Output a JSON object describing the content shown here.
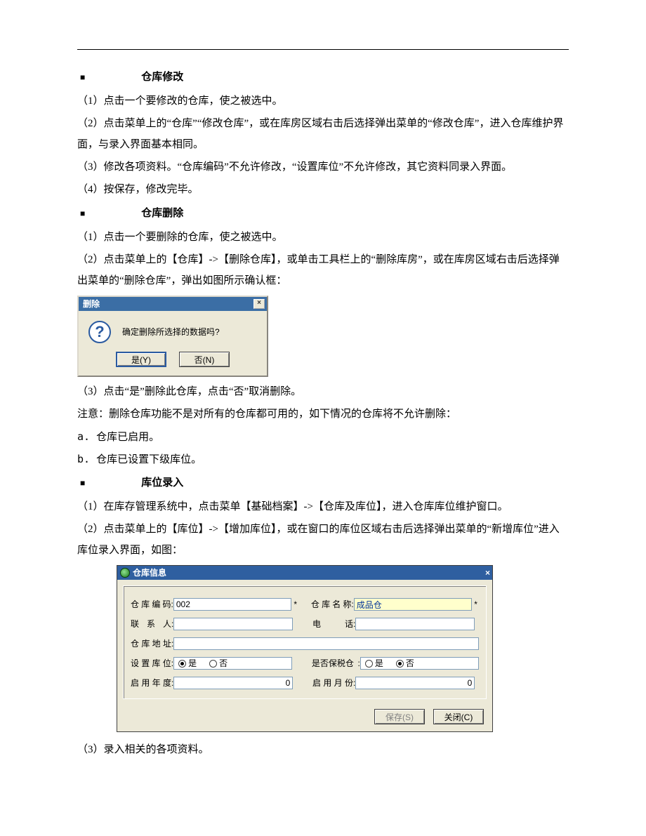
{
  "sections": {
    "modify": {
      "title": "仓库修改",
      "p1": "（1）点击一个要修改的仓库，使之被选中。",
      "p2": "（2）点击菜单上的“仓库”“修改仓库”，或在库房区域右击后选择弹出菜单的“修改仓库”，进入仓库维护界面，与录入界面基本相同。",
      "p3": "（3）修改各项资料。“仓库编码”不允许修改，“设置库位”不允许修改，其它资料同录入界面。",
      "p4": "（4）按保存，修改完毕。"
    },
    "delete": {
      "title": "仓库删除",
      "p1": "（1）点击一个要删除的仓库，使之被选中。",
      "p2": "（2）点击菜单上的【仓库】->【删除仓库】，或单击工具栏上的“删除库房”，或在库房区域右击后选择弹出菜单的“删除仓库”，弹出如图所示确认框：",
      "p3": "（3）点击“是”删除此仓库，点击“否”取消删除。",
      "note": "注意：删除仓库功能不是对所有的仓库都可用的，如下情况的仓库将不允许删除：",
      "a": "a. 仓库已启用。",
      "b": "b. 仓库已设置下级库位。"
    },
    "locInput": {
      "title": "库位录入",
      "p1": "（1）在库存管理系统中，点击菜单【基础档案】->【仓库及库位】，进入仓库库位维护窗口。",
      "p2": "（2）点击菜单上的【库位】->【增加库位】，或在窗口的库位区域右击后选择弹出菜单的“新增库位”进入库位录入界面，如图：",
      "p3": "（3）录入相关的各项资料。"
    }
  },
  "dialogs": {
    "confirm": {
      "title": "删除",
      "message": "确定删除所选择的数据吗?",
      "yes": "是(Y)",
      "no": "否(N)"
    },
    "info": {
      "title": "仓库信息",
      "labels": {
        "code": "仓库编码",
        "name": "仓库名称",
        "contact": "联 系 人",
        "phone": "电　　话",
        "address": "仓库地址",
        "setloc": "设置库位",
        "bonded": "是否保税仓",
        "year": "启用年度",
        "month": "启用月份"
      },
      "values": {
        "code": "002",
        "name": "成品仓",
        "contact": "",
        "phone": "",
        "address": "",
        "year": "0",
        "month": "0"
      },
      "radio": {
        "yes": "是",
        "no": "否",
        "setloc_selected": "yes",
        "bonded_selected": "no"
      },
      "buttons": {
        "save": "保存(S)",
        "close": "关闭(C)"
      },
      "star": "*"
    }
  }
}
